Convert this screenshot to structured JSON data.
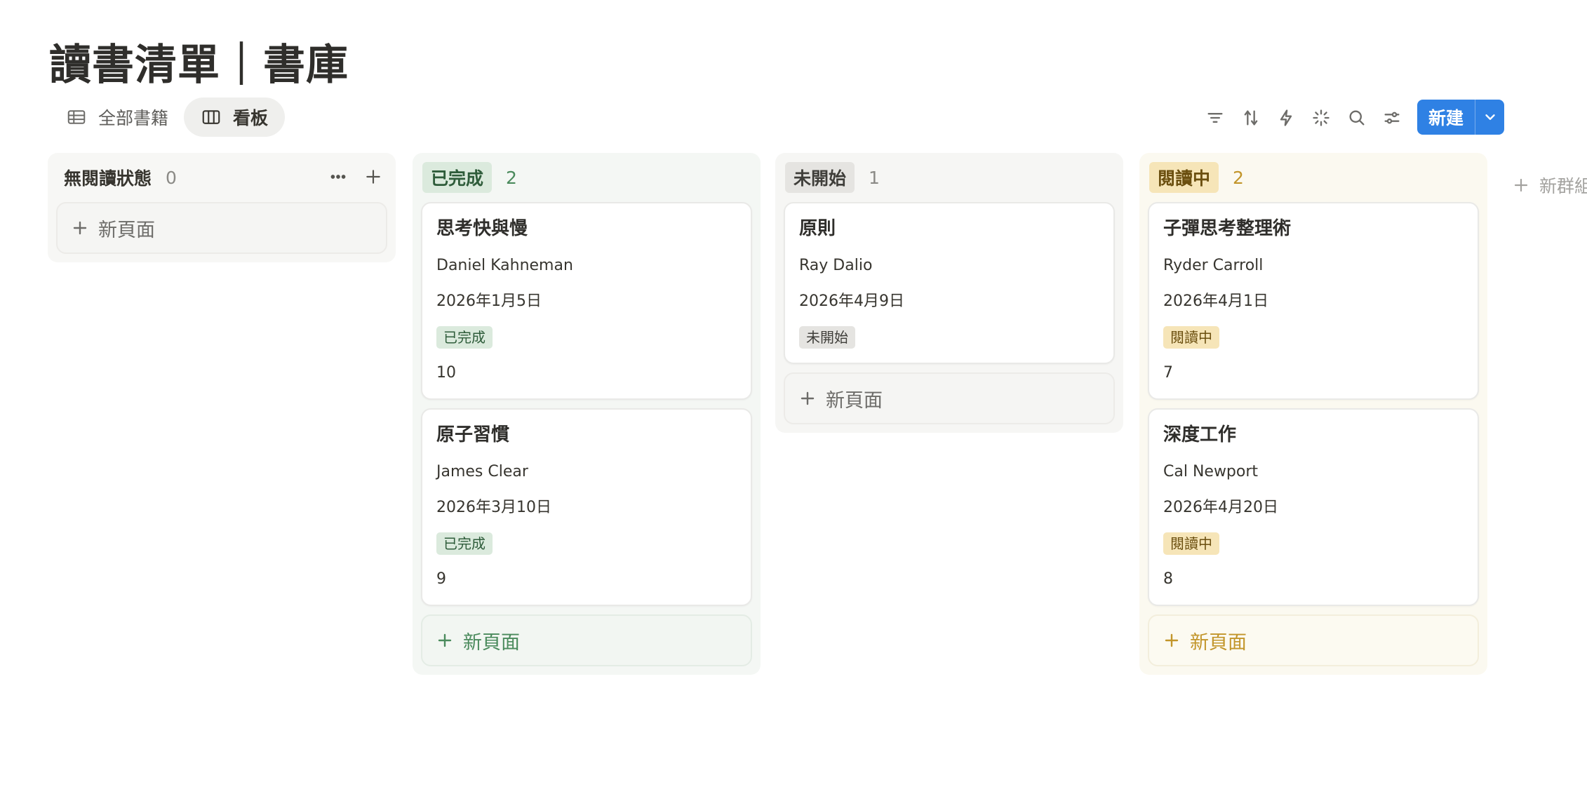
{
  "page": {
    "title": "讀書清單｜書庫"
  },
  "views": [
    {
      "label": "全部書籍",
      "icon": "table-icon",
      "active": false
    },
    {
      "label": "看板",
      "icon": "board-icon",
      "active": true
    }
  ],
  "toolbar": {
    "icons": [
      "filter-icon",
      "sort-icon",
      "lightning-icon",
      "sparkle-icon",
      "search-icon",
      "settings-icon"
    ],
    "new_label": "新建",
    "new_dropdown_icon": "chevron-down-icon",
    "primary_color": "#2f81e4"
  },
  "columns": [
    {
      "title": "無閱讀狀態",
      "count": "0",
      "new_page_label": "新頁面",
      "cards": []
    },
    {
      "title": "已完成",
      "count": "2",
      "color": "green",
      "new_page_label": "新頁面",
      "cards": [
        {
          "title": "思考快與慢",
          "author": "Daniel Kahneman",
          "date": "2026年1月5日",
          "status": "已完成",
          "rating": "10"
        },
        {
          "title": "原子習慣",
          "author": "James Clear",
          "date": "2026年3月10日",
          "status": "已完成",
          "rating": "9"
        }
      ]
    },
    {
      "title": "未開始",
      "count": "1",
      "color": "gray",
      "new_page_label": "新頁面",
      "cards": [
        {
          "title": "原則",
          "author": "Ray Dalio",
          "date": "2026年4月9日",
          "status": "未開始"
        }
      ]
    },
    {
      "title": "閱讀中",
      "count": "2",
      "color": "yellow",
      "new_page_label": "新頁面",
      "cards": [
        {
          "title": "子彈思考整理術",
          "author": "Ryder Carroll",
          "date": "2026年4月1日",
          "status": "閱讀中",
          "rating": "7"
        },
        {
          "title": "深度工作",
          "author": "Cal Newport",
          "date": "2026年4月20日",
          "status": "閱讀中",
          "rating": "8"
        }
      ]
    }
  ],
  "add_group_label": "新群組"
}
